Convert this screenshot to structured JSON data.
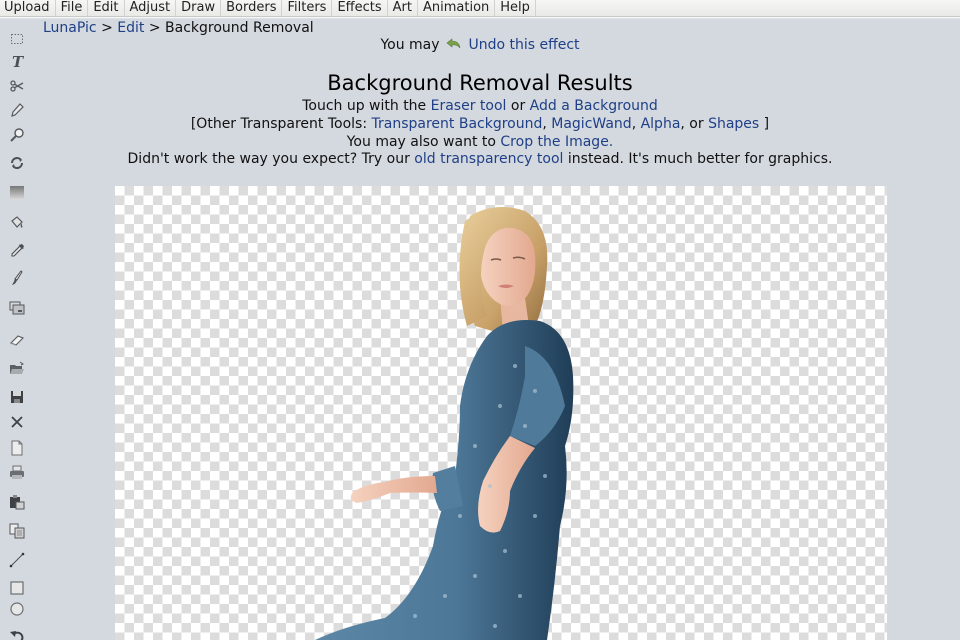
{
  "menubar": {
    "items": [
      "Upload",
      "File",
      "Edit",
      "Adjust",
      "Draw",
      "Borders",
      "Filters",
      "Effects",
      "Art",
      "Animation",
      "Help"
    ]
  },
  "toolbar": {
    "tools": [
      {
        "name": "marquee-select",
        "icon": "dotted-rectangle-icon"
      },
      {
        "name": "text",
        "icon": "text-t-icon"
      },
      {
        "name": "scissors",
        "icon": "scissors-icon"
      },
      {
        "name": "pencil",
        "icon": "pencil-icon"
      },
      {
        "name": "zoom",
        "icon": "magnifier-icon"
      },
      {
        "name": "rotate",
        "icon": "rotate-arrows-icon"
      },
      {
        "name": "gradient",
        "icon": "gradient-icon"
      },
      {
        "name": "paint-bucket",
        "icon": "paint-bucket-icon"
      },
      {
        "name": "eyedropper",
        "icon": "eyedropper-icon"
      },
      {
        "name": "brush",
        "icon": "brush-icon"
      },
      {
        "name": "layers",
        "icon": "layers-icon"
      },
      {
        "name": "eraser",
        "icon": "eraser-icon"
      },
      {
        "name": "open",
        "icon": "folder-open-icon"
      },
      {
        "name": "save",
        "icon": "floppy-disk-icon"
      },
      {
        "name": "close",
        "icon": "close-x-icon"
      },
      {
        "name": "new",
        "icon": "document-icon"
      },
      {
        "name": "print",
        "icon": "printer-icon"
      },
      {
        "name": "paste",
        "icon": "clipboard-icon"
      },
      {
        "name": "copy",
        "icon": "copy-icon"
      },
      {
        "name": "line",
        "icon": "line-icon"
      },
      {
        "name": "rectangle",
        "icon": "square-icon"
      },
      {
        "name": "circle",
        "icon": "circle-icon"
      },
      {
        "name": "undo",
        "icon": "undo-arrow-icon"
      }
    ]
  },
  "breadcrumb": {
    "items": [
      {
        "label": "LunaPic",
        "link": true
      },
      {
        "label": "Edit",
        "link": true
      },
      {
        "label": "Background Removal",
        "link": false
      }
    ],
    "separator": ">"
  },
  "undo_line": {
    "prefix": "You may",
    "link": "Undo this effect"
  },
  "title": "Background Removal Results",
  "info": {
    "line1": {
      "prefix": "Touch up with the ",
      "link1": "Eraser tool",
      "middle": " or ",
      "link2": "Add a Background"
    },
    "line2": {
      "prefix": "[Other Transparent Tools: ",
      "links": [
        "Transparent Background",
        "MagicWand",
        "Alpha",
        "Shapes"
      ],
      "seps": [
        ", ",
        ", ",
        ", or "
      ],
      "suffix": " ]"
    },
    "line3": {
      "prefix": "You may also want to ",
      "link": "Crop the Image."
    },
    "line4": {
      "prefix": "Didn't work the way you expect? Try our ",
      "link": "old transparency tool",
      "suffix": " instead. It's much better for graphics."
    }
  },
  "canvas": {
    "subject": "woman-in-blue-dress",
    "background": "transparent-checkerboard"
  },
  "colors": {
    "link": "#1f3f86",
    "page_bg": "#d4d9e0",
    "dress": "#4f7a99"
  }
}
